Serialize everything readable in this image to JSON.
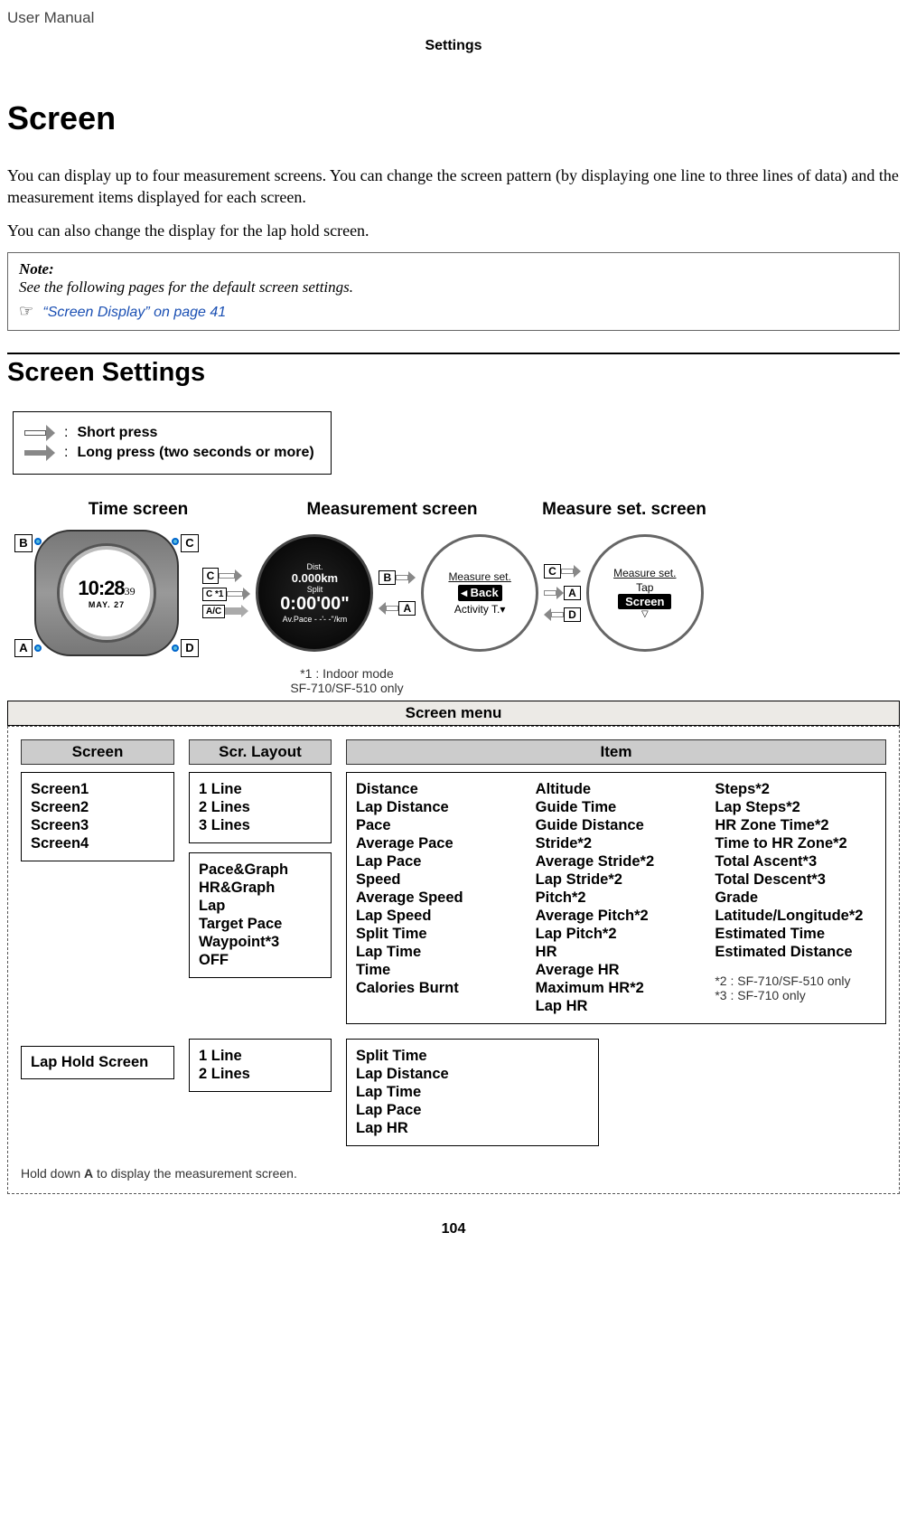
{
  "header": {
    "manual": "User Manual",
    "section": "Settings"
  },
  "title": "Screen",
  "para1": "You can display up to four measurement screens. You can change the screen pattern (by displaying one line to three lines of data) and the measurement items displayed for each screen.",
  "para2": "You can also change the display for the lap hold screen.",
  "note": {
    "label": "Note:",
    "body": "See the following pages for the default screen settings.",
    "xref": "“Screen Display” on page 41",
    "hand": "☞"
  },
  "section2": "Screen Settings",
  "legend": {
    "short": "Short press",
    "long": "Long press (two seconds or more)",
    "colon": ":"
  },
  "nav": {
    "time_label": "Time screen",
    "meas_label": "Measurement screen",
    "set_label": "Measure set. screen",
    "watch_time": "10:28",
    "watch_sec": "39",
    "watch_date": "MAY. 27",
    "btn_a": "A",
    "btn_b": "B",
    "btn_c": "C",
    "btn_d": "D",
    "btn_c_star": "C *1",
    "btn_ac": "A/C",
    "meas_top": "Dist.",
    "meas_dist": "0.000km",
    "meas_split_lbl": "Split",
    "meas_split": "0:00'00\"",
    "meas_pace_lbl": "Av.Pace",
    "meas_pace": "- -'- -\"/km",
    "set1_title": "Measure set.",
    "set1_back": "◂ Back",
    "set1_activity": "Activity T.▾",
    "set2_title": "Measure set.",
    "set2_tap": "Tap",
    "set2_screen": "Screen",
    "footnote1": "*1 : Indoor mode",
    "footnote2": "SF-710/SF-510 only"
  },
  "menu": {
    "bar": "Screen menu",
    "col_screen": "Screen",
    "col_layout": "Scr. Layout",
    "col_item": "Item",
    "screens": [
      "Screen1",
      "Screen2",
      "Screen3",
      "Screen4"
    ],
    "lap_hold": "Lap Hold Screen",
    "layouts1": [
      "1 Line",
      "2 Lines",
      "3 Lines"
    ],
    "layouts2": [
      "Pace&Graph",
      "HR&Graph",
      "Lap",
      "Target Pace",
      "Waypoint*3",
      "OFF"
    ],
    "layouts3": [
      "1 Line",
      "2 Lines"
    ],
    "items_col1": [
      "Distance",
      "Lap Distance",
      "Pace",
      "Average Pace",
      "Lap Pace",
      "Speed",
      "Average Speed",
      "Lap Speed",
      "Split Time",
      "Lap Time",
      "Time",
      "Calories Burnt"
    ],
    "items_col2": [
      "Altitude",
      "Guide Time",
      "Guide Distance",
      "Stride*2",
      "Average Stride*2",
      "Lap Stride*2",
      "Pitch*2",
      "Average Pitch*2",
      "Lap Pitch*2",
      "HR",
      "Average HR",
      "Maximum HR*2",
      "Lap HR"
    ],
    "items_col3": [
      "Steps*2",
      "Lap Steps*2",
      "HR Zone Time*2",
      "Time to HR Zone*2",
      "Total Ascent*3",
      "Total Descent*3",
      "Grade",
      "Latitude/Longitude*2",
      "Estimated Time",
      "Estimated Distance"
    ],
    "items2": [
      "Split Time",
      "Lap Distance",
      "Lap Time",
      "Lap Pace",
      "Lap HR"
    ],
    "star2": "*2 : SF-710/SF-510 only",
    "star3": "*3 : SF-710 only",
    "hold_note_pre": "Hold down ",
    "hold_note_bold": "A",
    "hold_note_post": " to display the measurement screen."
  },
  "page_number": "104"
}
